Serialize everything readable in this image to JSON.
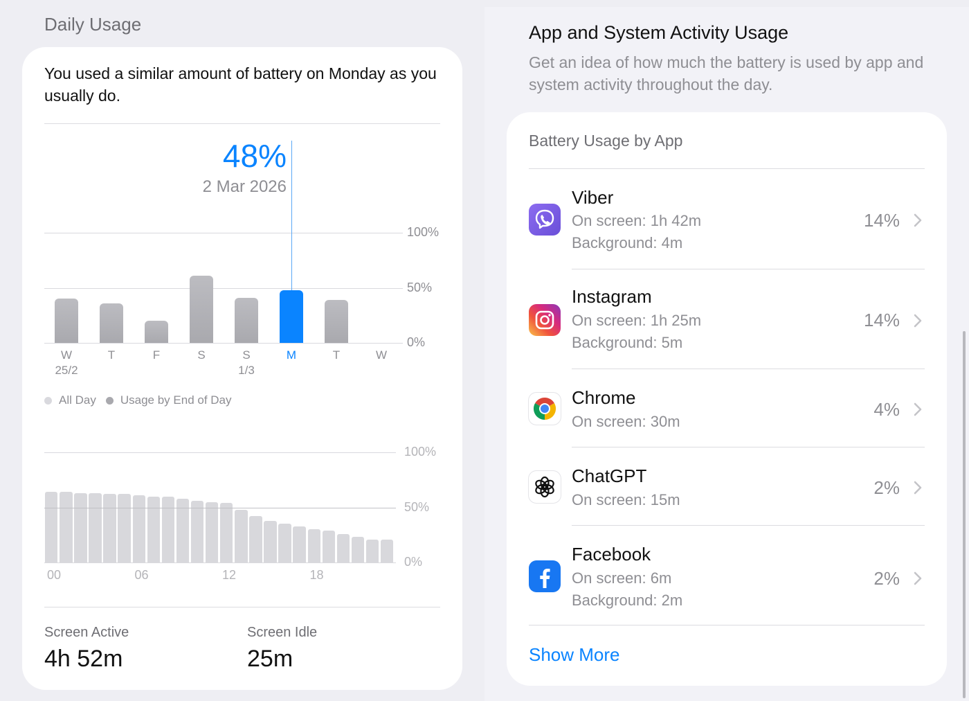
{
  "daily_usage": {
    "section_title": "Daily Usage",
    "headline": "You used a similar amount of battery on Monday as you usually do.",
    "callout": {
      "value": "48%",
      "date": "2 Mar 2026"
    },
    "daily_chart": {
      "y_ticks": [
        "100%",
        "50%",
        "0%"
      ],
      "days": [
        {
          "label": "W",
          "sub": "25/2",
          "value": 40
        },
        {
          "label": "T",
          "sub": "",
          "value": 36
        },
        {
          "label": "F",
          "sub": "",
          "value": 20
        },
        {
          "label": "S",
          "sub": "",
          "value": 61
        },
        {
          "label": "S",
          "sub": "1/3",
          "value": 41
        },
        {
          "label": "M",
          "sub": "",
          "value": 48,
          "selected": true
        },
        {
          "label": "T",
          "sub": "",
          "value": 39
        },
        {
          "label": "W",
          "sub": "",
          "value": 0
        }
      ]
    },
    "legend": [
      {
        "label": "All Day",
        "color": "#d9d9de"
      },
      {
        "label": "Usage by End of Day",
        "color": "#a9a9ae"
      }
    ],
    "hourly_chart": {
      "y_ticks": [
        "100%",
        "50%",
        "0%"
      ],
      "x_ticks": [
        "00",
        "06",
        "12",
        "18"
      ],
      "values": [
        64,
        64,
        63,
        63,
        62,
        62,
        61,
        60,
        60,
        58,
        56,
        55,
        54,
        48,
        42,
        38,
        35,
        33,
        30,
        29,
        26,
        23,
        21,
        21
      ]
    },
    "stats": {
      "active_label": "Screen Active",
      "active_value": "4h 52m",
      "idle_label": "Screen Idle",
      "idle_value": "25m"
    }
  },
  "activity": {
    "title": "App and System Activity Usage",
    "description": "Get an idea of how much the battery is used by app and system activity throughout the day.",
    "card_title": "Battery Usage by App",
    "apps": [
      {
        "name": "Viber",
        "onscreen": "On screen: 1h 42m",
        "background": "Background: 4m",
        "percent": "14%",
        "icon": "viber-icon"
      },
      {
        "name": "Instagram",
        "onscreen": "On screen: 1h 25m",
        "background": "Background: 5m",
        "percent": "14%",
        "icon": "instagram-icon"
      },
      {
        "name": "Chrome",
        "onscreen": "On screen: 30m",
        "background": "",
        "percent": "4%",
        "icon": "chrome-icon"
      },
      {
        "name": "ChatGPT",
        "onscreen": "On screen: 15m",
        "background": "",
        "percent": "2%",
        "icon": "chatgpt-icon"
      },
      {
        "name": "Facebook",
        "onscreen": "On screen: 6m",
        "background": "Background: 2m",
        "percent": "2%",
        "icon": "facebook-icon"
      }
    ],
    "show_more": "Show More"
  },
  "colors": {
    "accent": "#0a84ff",
    "bar": "#a9a9ae",
    "hourly_bar": "#d8d8dc"
  }
}
